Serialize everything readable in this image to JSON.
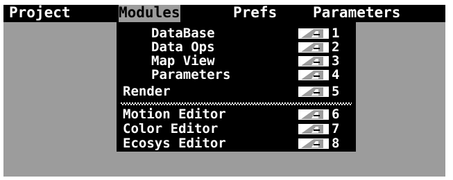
{
  "menubar": {
    "menus": [
      {
        "label": "Project"
      },
      {
        "label": "Modules"
      },
      {
        "label": "Prefs"
      },
      {
        "label": "Parameters"
      }
    ]
  },
  "dropdown": {
    "items": [
      {
        "label": "DataBase",
        "key": "1"
      },
      {
        "label": "Data Ops",
        "key": "2"
      },
      {
        "label": "Map View",
        "key": "3"
      },
      {
        "label": "Parameters",
        "key": "4"
      },
      {
        "label": "Render",
        "key": "5"
      },
      {
        "label": "Motion Editor",
        "key": "6"
      },
      {
        "label": "Color Editor",
        "key": "7"
      },
      {
        "label": "Ecosys Editor",
        "key": "8"
      }
    ]
  },
  "colors": {
    "background": "#9c9c9c",
    "menu": "#000000",
    "text": "#ffffff"
  },
  "icons": {
    "shortcut_modifier": "amiga-key-icon"
  }
}
